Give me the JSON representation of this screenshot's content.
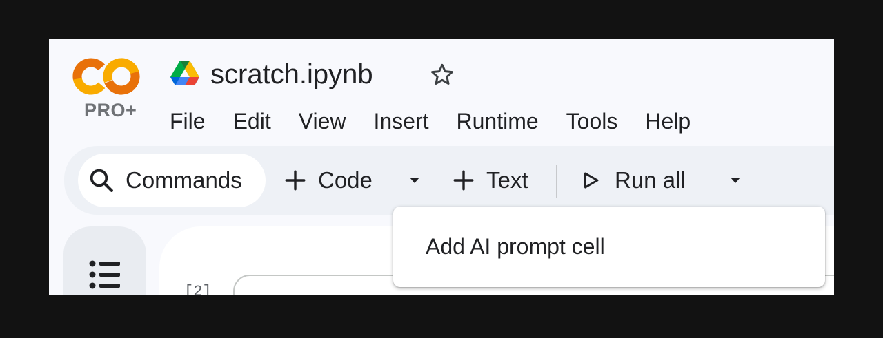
{
  "app": {
    "logo_text": "CO",
    "plan_badge": "PRO+",
    "notebook_title": "scratch.ipynb"
  },
  "menu": [
    {
      "label": "File"
    },
    {
      "label": "Edit"
    },
    {
      "label": "View"
    },
    {
      "label": "Insert"
    },
    {
      "label": "Runtime"
    },
    {
      "label": "Tools"
    },
    {
      "label": "Help"
    }
  ],
  "toolbar": {
    "commands_label": "Commands",
    "code_label": "Code",
    "text_label": "Text",
    "run_all_label": "Run all"
  },
  "cell": {
    "execution_count": "[2]"
  },
  "dropdown": {
    "items": [
      {
        "label": "Add AI prompt cell"
      }
    ]
  },
  "icons": {
    "logo": "colab-logo-icon",
    "drive": "google-drive-icon",
    "star": "star-icon",
    "search": "search-icon",
    "plus": "plus-icon",
    "chevron": "chevron-down-icon",
    "play": "play-outline-icon",
    "toc": "table-of-contents-icon"
  },
  "colors": {
    "logo_orange_dark": "#e8710a",
    "logo_orange_light": "#f9ab00",
    "frame_bg": "#f8f9fd",
    "toolbar_bg": "#eef1f6",
    "text": "#202124"
  }
}
